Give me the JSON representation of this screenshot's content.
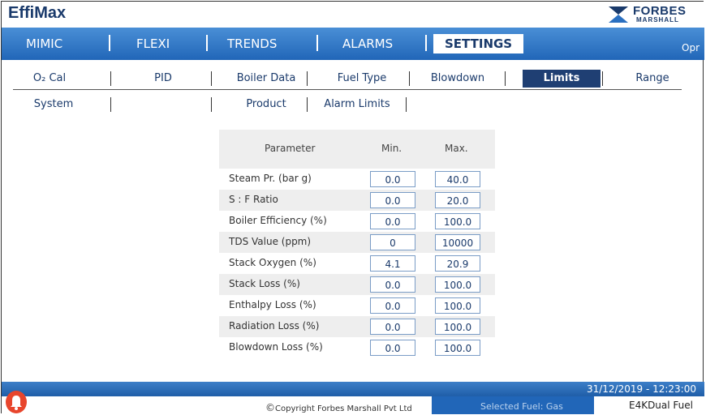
{
  "app": {
    "title": "EffiMax",
    "logo_line1": "FORBES",
    "logo_line2": "MARSHALL"
  },
  "colors": {
    "nav_blue": "#2166b8",
    "dark_navy": "#1f3f73",
    "alarm_red": "#e8452c"
  },
  "main_nav": {
    "tabs": [
      "MIMIC",
      "FLEXI",
      "TRENDS",
      "ALARMS",
      "SETTINGS"
    ],
    "active": "SETTINGS",
    "user_level": "Opr"
  },
  "sub_nav": {
    "row1": [
      "O₂ Cal",
      "PID",
      "Boiler Data",
      "Fuel Type",
      "Blowdown",
      "Limits",
      "Range"
    ],
    "row2": [
      "System",
      "",
      "Product",
      "Alarm Limits"
    ],
    "active": "Limits"
  },
  "limits_table": {
    "headers": {
      "parameter": "Parameter",
      "min": "Min.",
      "max": "Max."
    },
    "rows": [
      {
        "parameter": "Steam Pr. (bar g)",
        "min": "0.0",
        "max": "40.0"
      },
      {
        "parameter": "S : F Ratio",
        "min": "0.0",
        "max": "20.0"
      },
      {
        "parameter": "Boiler Efficiency (%)",
        "min": "0.0",
        "max": "100.0"
      },
      {
        "parameter": "TDS Value (ppm)",
        "min": "0",
        "max": "10000"
      },
      {
        "parameter": "Stack Oxygen (%)",
        "min": "4.1",
        "max": "20.9"
      },
      {
        "parameter": "Stack Loss (%)",
        "min": "0.0",
        "max": "100.0"
      },
      {
        "parameter": "Enthalpy Loss (%)",
        "min": "0.0",
        "max": "100.0"
      },
      {
        "parameter": "Radiation Loss (%)",
        "min": "0.0",
        "max": "100.0"
      },
      {
        "parameter": "Blowdown Loss (%)",
        "min": "0.0",
        "max": "100.0"
      }
    ]
  },
  "footer": {
    "datetime": "31/12/2019 - 12:23:00",
    "copyright_symbol": "©",
    "copyright": "Copyright Forbes Marshall Pvt Ltd",
    "selected_fuel": "Selected Fuel: Gas",
    "mode": "E4KDual Fuel",
    "alarm_icon": "alarm-bell-icon"
  }
}
